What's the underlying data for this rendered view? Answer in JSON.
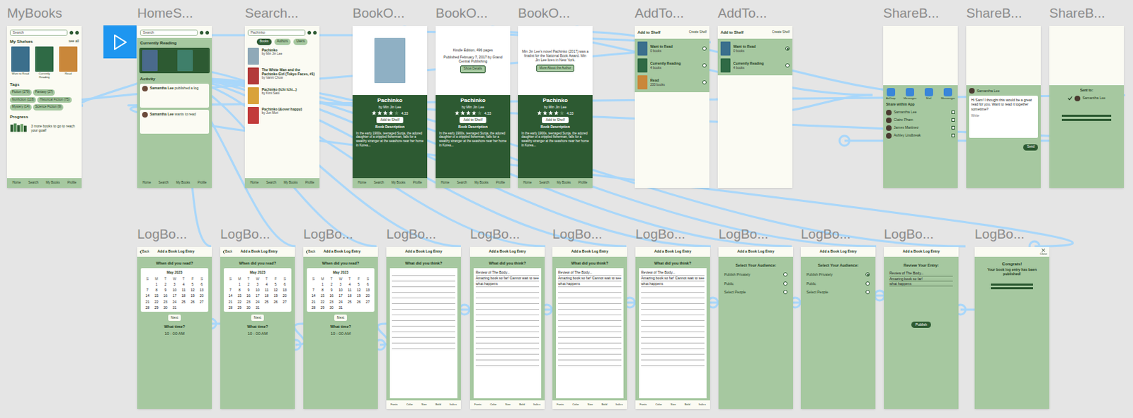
{
  "frames": [
    {
      "title": "MyBooks",
      "kind": "shelves",
      "search": "Search",
      "shelves_heading": "My Shelves",
      "see_all": "see all",
      "shelves": [
        {
          "label": "Want to Read",
          "color": "#3b6f8c"
        },
        {
          "label": "Currently Reading",
          "color": "#2f6a45"
        },
        {
          "label": "Read",
          "color": "#c9873a"
        }
      ],
      "tags_heading": "Tags",
      "tags": [
        "Fiction (179)",
        "Fantasy (27)",
        "Nonfiction (118)",
        "Historical Fiction (75)",
        "Mystery (14)",
        "Science Fiction (9)"
      ],
      "progress_heading": "Progress",
      "progress_text": "3 more books to go to reach your goal!",
      "nav": [
        "Home",
        "Search",
        "My Books",
        "Profile"
      ]
    },
    {
      "title": "HomeS...",
      "kind": "home",
      "search": "Search",
      "current_heading": "Currently Reading",
      "covers": [
        {
          "color": "#4a6a8c"
        },
        {
          "color": "#2d5a32"
        },
        {
          "color": "#3f7f6a"
        }
      ],
      "activity_heading": "Activity",
      "posts": [
        {
          "user": "Samantha Lee",
          "action": "published a log"
        },
        {
          "user": "Samantha Lee",
          "action": "wants to read"
        }
      ],
      "nav": [
        "Home",
        "Search",
        "My Books",
        "Profile"
      ]
    },
    {
      "title": "Search...",
      "kind": "search",
      "query": "Pachinko",
      "filters": [
        {
          "label": "Books",
          "selected": true
        },
        {
          "label": "Authors",
          "selected": false
        },
        {
          "label": "Users",
          "selected": false
        }
      ],
      "results": [
        {
          "title": "Pachinko",
          "author": "by Min Jin Lee",
          "color": "#8fa9b8"
        },
        {
          "title": "The White Man and the Pachinko Girl (Tokyo Faces, #1)",
          "author": "by Vanni Chow",
          "color": "#b33a3a"
        },
        {
          "title": "Pachinko (Ichi Ichi...)",
          "author": "by Kimi Sato",
          "color": "#d9a23a"
        },
        {
          "title": "Pachinko (&over happy)",
          "author": "by Jun Mori",
          "color": "#c23b3b"
        }
      ],
      "nav": [
        "Home",
        "Search",
        "My Books",
        "Profile"
      ]
    },
    {
      "title": "BookO...",
      "kind": "book",
      "top": {
        "kind": "cover",
        "color": "#8fb0c4",
        "texts": [],
        "button": ""
      },
      "name": "Pachinko",
      "author": "by Min Jin Lee",
      "stars": 4,
      "rating": "4.33",
      "button": "Add to Shelf",
      "description_heading": "Book Description",
      "description": "In the early 1900s, teenaged Sunja, the adored daughter of a crippled fisherman, falls for a wealthy stranger at the seashore near her home in Korea...",
      "nav": [
        "Home",
        "Search",
        "My Books",
        "Profile"
      ]
    },
    {
      "title": "BookO...",
      "kind": "book",
      "top": {
        "kind": "details",
        "color": "#ffffff",
        "texts": [
          "Kindle Edition, 496 pages",
          "Published February 7, 2017 by Grand Central Publishing"
        ],
        "button": "Show Details"
      },
      "name": "Pachinko",
      "author": "by Min Jin Lee",
      "stars": 4,
      "rating": "4.33",
      "button": "Add to Shelf",
      "description_heading": "Book Description",
      "description": "In the early 1900s, teenaged Sunja, the adored daughter of a crippled fisherman, falls for a wealthy stranger at the seashore near her home in Korea...",
      "nav": [
        "Home",
        "Search",
        "My Books",
        "Profile"
      ]
    },
    {
      "title": "BookO...",
      "kind": "book",
      "top": {
        "kind": "details",
        "color": "#ffffff",
        "texts": [
          "Min Jin Lee's novel Pachinko (2017) was a finalist for the National Book Award. Min Jin Lee lives in New York."
        ],
        "button": "More About the Author"
      },
      "name": "Pachinko",
      "author": "by Min Jin Lee",
      "stars": 4,
      "rating": "4.33",
      "button": "Add to Shelf",
      "description_heading": "Book Description",
      "description": "In the early 1900s, teenaged Sunja, the adored daughter of a crippled fisherman, falls for a wealthy stranger at the seashore near her home in Korea...",
      "nav": [
        "Home",
        "Search",
        "My Books",
        "Profile"
      ]
    },
    {
      "title": "AddTo...",
      "kind": "shelf",
      "heading": "Add to Shelf",
      "create": "Create Shelf",
      "options": [
        {
          "label": "Want to Read",
          "count": "0 books",
          "color": "#3b6f8c",
          "selected": false
        },
        {
          "label": "Currently Reading",
          "count": "4 books",
          "color": "#2f6a45",
          "selected": false
        },
        {
          "label": "Read",
          "count": "200 books",
          "color": "#c9873a",
          "selected": false
        }
      ]
    },
    {
      "title": "AddTo...",
      "kind": "shelf",
      "heading": "Add to Shelf",
      "create": "Create Shelf",
      "options": [
        {
          "label": "Want to Read",
          "count": "0 books",
          "color": "#3b6f8c",
          "selected": true
        },
        {
          "label": "Currently Reading",
          "count": "4 books",
          "color": "#2f6a45",
          "selected": false
        }
      ]
    },
    {
      "title": "ShareB...",
      "kind": "share",
      "apps": [
        "AirDrop",
        "Messages",
        "Mail",
        "Messenger"
      ],
      "in_app_heading": "Share within App",
      "contacts": [
        {
          "name": "Samantha Lee",
          "selected": false
        },
        {
          "name": "Claire Pham",
          "selected": false
        },
        {
          "name": "James Martinez",
          "selected": false
        },
        {
          "name": "Ashley Lindbreak",
          "selected": false
        }
      ]
    },
    {
      "title": "ShareB...",
      "kind": "share-message",
      "to": "Samantha Lee",
      "message": "Hi Sam! I thought this would be a great read for you. Want to read it together sometime?",
      "hint": "Write",
      "button": "Send"
    },
    {
      "title": "ShareB...",
      "kind": "share-sent",
      "heading": "Sent to:",
      "recipients": [
        {
          "name": "Samantha Lee",
          "selected": true
        }
      ]
    },
    {
      "title": "LogBo...",
      "kind": "log-date",
      "header": "Add a Book Log Entry",
      "back": "Back",
      "question": "When did you read?",
      "month": "May 2023",
      "weekdays": [
        "S",
        "M",
        "T",
        "W",
        "T",
        "F",
        "S"
      ],
      "first_weekday_index": 1,
      "days": [
        "1",
        "2",
        "3",
        "4",
        "5",
        "6",
        "7",
        "8",
        "9",
        "10",
        "11",
        "12",
        "13",
        "14",
        "15",
        "16",
        "17",
        "18",
        "19",
        "20",
        "21",
        "22",
        "23",
        "24",
        "25",
        "26",
        "27",
        "28",
        "29",
        "30",
        "31"
      ],
      "time_question": "What time?",
      "time": "10 : 00 AM",
      "next": "Next"
    },
    {
      "title": "LogBo...",
      "kind": "log-date",
      "header": "Add a Book Log Entry",
      "back": "Back",
      "question": "When did you read?",
      "month": "May 2023",
      "weekdays": [
        "S",
        "M",
        "T",
        "W",
        "T",
        "F",
        "S"
      ],
      "first_weekday_index": 1,
      "days": [
        "1",
        "2",
        "3",
        "4",
        "5",
        "6",
        "7",
        "8",
        "9",
        "10",
        "11",
        "12",
        "13",
        "14",
        "15",
        "16",
        "17",
        "18",
        "19",
        "20",
        "21",
        "22",
        "23",
        "24",
        "25",
        "26",
        "27",
        "28",
        "29",
        "30",
        "31"
      ],
      "time_question": "What time?",
      "time": "10 : 00 AM",
      "next": "Next"
    },
    {
      "title": "LogBo...",
      "kind": "log-date",
      "header": "Add a Book Log Entry",
      "back": "Back",
      "question": "When did you read?",
      "month": "May 2023",
      "weekdays": [
        "S",
        "M",
        "T",
        "W",
        "T",
        "F",
        "S"
      ],
      "first_weekday_index": 1,
      "days": [
        "1",
        "2",
        "3",
        "4",
        "5",
        "6",
        "7",
        "8",
        "9",
        "10",
        "11",
        "12",
        "13",
        "14",
        "15",
        "16",
        "17",
        "18",
        "19",
        "20",
        "21",
        "22",
        "23",
        "24",
        "25",
        "26",
        "27",
        "28",
        "29",
        "30",
        "31"
      ],
      "time_question": "What time?",
      "time": "10 : 00 AM",
      "next": "Next"
    },
    {
      "title": "LogBo...",
      "kind": "log-text",
      "header": "Add a Book Log Entry",
      "question": "What did you think?",
      "entries": [],
      "toolbar": [
        "Fonts",
        "Color",
        "Size",
        "Bold",
        "Italics"
      ]
    },
    {
      "title": "LogBo...",
      "kind": "log-text",
      "header": "Add a Book Log Entry",
      "question": "What did you think?",
      "entries": [
        "Review of The Body...",
        "Amazing book so far! Cannot wait to see",
        "what happens"
      ],
      "toolbar": [
        "Fonts",
        "Color",
        "Size",
        "Bold",
        "Italics"
      ]
    },
    {
      "title": "LogBo...",
      "kind": "log-text",
      "header": "Add a Book Log Entry",
      "question": "What did you think?",
      "entries": [
        "Review of The Body...",
        "Amazing book so far! Cannot wait to see",
        "what happens"
      ],
      "toolbar": [
        "Fonts",
        "Color",
        "Size",
        "Bold",
        "Italics"
      ]
    },
    {
      "title": "LogBo...",
      "kind": "log-text",
      "header": "Add a Book Log Entry",
      "question": "What did you think?",
      "entries": [
        "Review of The Body...",
        "Amazing book so far! Cannot wait to see",
        "what happens"
      ],
      "toolbar": [
        "Fonts",
        "Color",
        "Size",
        "Bold",
        "Italics"
      ]
    },
    {
      "title": "LogBo...",
      "kind": "log-audience",
      "header": "Add a Book Log Entry",
      "question": "Select Your Audience:",
      "options": [
        {
          "label": "Publish Privately",
          "selected": false
        },
        {
          "label": "Public",
          "selected": false
        },
        {
          "label": "Select People",
          "selected": false
        }
      ]
    },
    {
      "title": "LogBo...",
      "kind": "log-audience",
      "header": "Add a Book Log Entry",
      "question": "Select Your Audience:",
      "options": [
        {
          "label": "Publish Privately",
          "selected": true
        },
        {
          "label": "Public",
          "selected": false
        },
        {
          "label": "Select People",
          "selected": false
        }
      ]
    },
    {
      "title": "LogBo...",
      "kind": "log-review",
      "header": "Add a Book Log Entry",
      "question": "Review Your Entry:",
      "entries": [
        "Review of The Body...",
        "Amazing book so far!",
        "what happens"
      ],
      "button": "Publish"
    },
    {
      "title": "LogBo...",
      "kind": "congrats",
      "heading": "Congrats!",
      "message": "Your book log entry has been published!",
      "close": "Close"
    }
  ]
}
